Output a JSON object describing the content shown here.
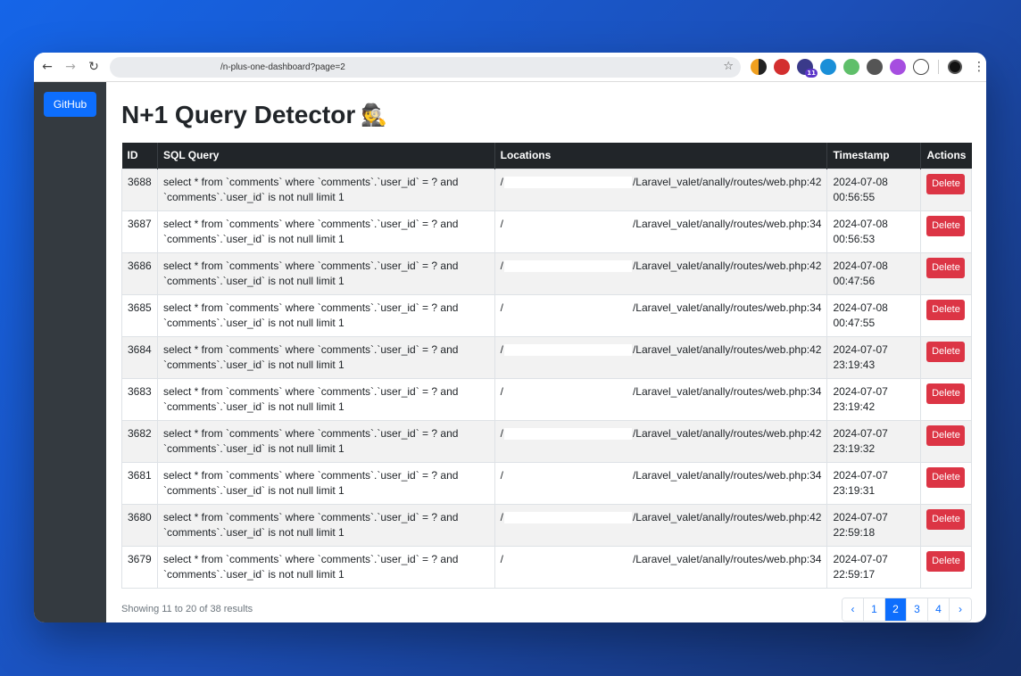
{
  "browser": {
    "url": "/n-plus-one-dashboard?page=2",
    "back_icon": "←",
    "forward_icon": "→",
    "reload_icon": "↻",
    "star_icon": "☆",
    "extension_badge": "11",
    "menu_icon": "⋮"
  },
  "sidebar": {
    "github_label": "GitHub"
  },
  "page": {
    "title": "N+1 Query Detector",
    "title_emoji": "🕵"
  },
  "table": {
    "headers": [
      "ID",
      "SQL Query",
      "Locations",
      "Timestamp",
      "Actions"
    ],
    "delete_label": "Delete",
    "rows": [
      {
        "id": "3688",
        "query": "select * from `comments` where `comments`.`user_id` = ? and `comments`.`user_id` is not null limit 1",
        "loc_prefix": "/",
        "loc_suffix": "/Laravel_valet/anally/routes/web.php:42",
        "date": "2024-07-08",
        "time": "00:56:55"
      },
      {
        "id": "3687",
        "query": "select * from `comments` where `comments`.`user_id` = ? and `comments`.`user_id` is not null limit 1",
        "loc_prefix": "/",
        "loc_suffix": "/Laravel_valet/anally/routes/web.php:34",
        "date": "2024-07-08",
        "time": "00:56:53"
      },
      {
        "id": "3686",
        "query": "select * from `comments` where `comments`.`user_id` = ? and `comments`.`user_id` is not null limit 1",
        "loc_prefix": "/",
        "loc_suffix": "/Laravel_valet/anally/routes/web.php:42",
        "date": "2024-07-08",
        "time": "00:47:56"
      },
      {
        "id": "3685",
        "query": "select * from `comments` where `comments`.`user_id` = ? and `comments`.`user_id` is not null limit 1",
        "loc_prefix": "/",
        "loc_suffix": "/Laravel_valet/anally/routes/web.php:34",
        "date": "2024-07-08",
        "time": "00:47:55"
      },
      {
        "id": "3684",
        "query": "select * from `comments` where `comments`.`user_id` = ? and `comments`.`user_id` is not null limit 1",
        "loc_prefix": "/",
        "loc_suffix": "/Laravel_valet/anally/routes/web.php:42",
        "date": "2024-07-07",
        "time": "23:19:43"
      },
      {
        "id": "3683",
        "query": "select * from `comments` where `comments`.`user_id` = ? and `comments`.`user_id` is not null limit 1",
        "loc_prefix": "/",
        "loc_suffix": "/Laravel_valet/anally/routes/web.php:34",
        "date": "2024-07-07",
        "time": "23:19:42"
      },
      {
        "id": "3682",
        "query": "select * from `comments` where `comments`.`user_id` = ? and `comments`.`user_id` is not null limit 1",
        "loc_prefix": "/",
        "loc_suffix": "/Laravel_valet/anally/routes/web.php:42",
        "date": "2024-07-07",
        "time": "23:19:32"
      },
      {
        "id": "3681",
        "query": "select * from `comments` where `comments`.`user_id` = ? and `comments`.`user_id` is not null limit 1",
        "loc_prefix": "/",
        "loc_suffix": "/Laravel_valet/anally/routes/web.php:34",
        "date": "2024-07-07",
        "time": "23:19:31"
      },
      {
        "id": "3680",
        "query": "select * from `comments` where `comments`.`user_id` = ? and `comments`.`user_id` is not null limit 1",
        "loc_prefix": "/",
        "loc_suffix": "/Laravel_valet/anally/routes/web.php:42",
        "date": "2024-07-07",
        "time": "22:59:18"
      },
      {
        "id": "3679",
        "query": "select * from `comments` where `comments`.`user_id` = ? and `comments`.`user_id` is not null limit 1",
        "loc_prefix": "/",
        "loc_suffix": "/Laravel_valet/anally/routes/web.php:34",
        "date": "2024-07-07",
        "time": "22:59:17"
      }
    ]
  },
  "footer": {
    "showing": "Showing 11 to 20 of 38 results",
    "prev": "‹",
    "next": "›",
    "pages": [
      "1",
      "2",
      "3",
      "4"
    ],
    "current_page": "2"
  },
  "colors": {
    "primary": "#0d6efd",
    "danger": "#dc3545",
    "sidebar": "#343a40",
    "table_header": "#212529"
  }
}
